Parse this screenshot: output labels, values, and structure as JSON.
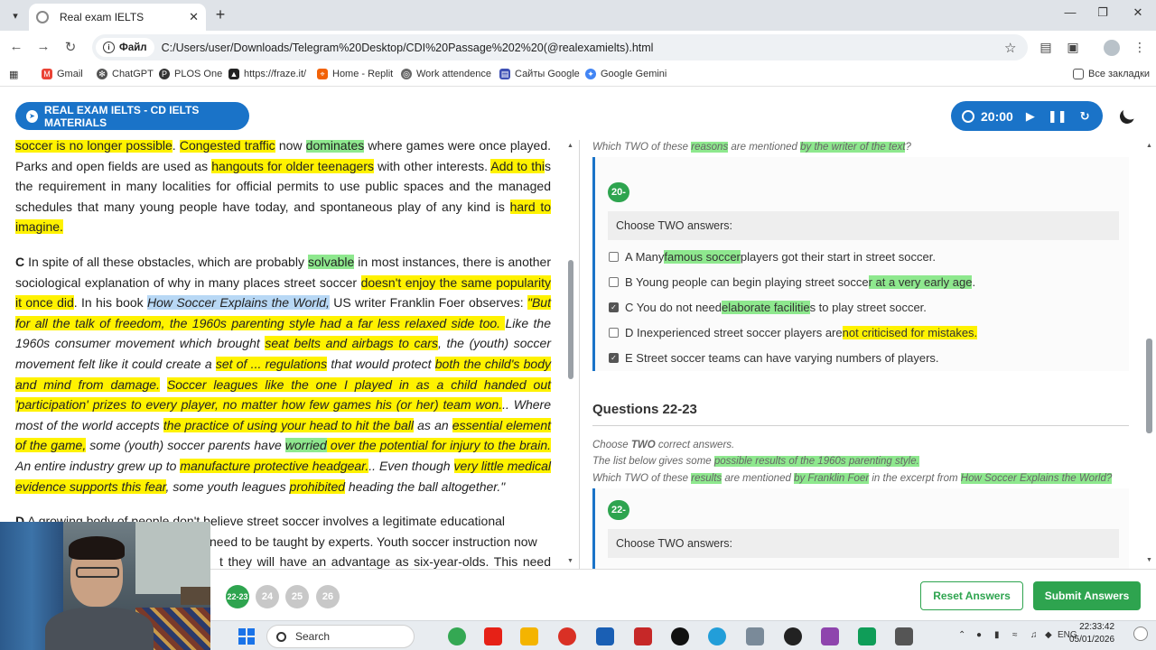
{
  "browser": {
    "tab_title": "Real exam IELTS",
    "file_chip": "Файл",
    "url": "C:/Users/user/Downloads/Telegram%20Desktop/CDI%20Passage%202%20(@realexamielts).html",
    "bookmarks": [
      "Gmail",
      "ChatGPT",
      "PLOS One",
      "https://fraze.it/",
      "Home - Replit",
      "Work attendence",
      "Сайты Google",
      "Google Gemini"
    ],
    "all_bookmarks": "Все закладки"
  },
  "header": {
    "brand_label": "REAL EXAM IELTS - CD IELTS MATERIALS",
    "timer": "20:00"
  },
  "passage": {
    "p1": {
      "s1": "soccer is no longer possible",
      "s2": ". ",
      "s3": "Congested traffic",
      "s4": " now ",
      "s5": "dominates",
      "s6": " where games were once played. Parks and open fields are used as ",
      "s7": "hangouts for older teenagers",
      "s8": " with other interests. ",
      "s9": "Add to thi",
      "s10": "s the requirement in many localities for official permits to use public spaces and the managed schedules that many young people have today, and spontaneous play of any kind is ",
      "s11": "hard to imagine."
    },
    "p2": {
      "letter": "C",
      "s1": " In spite of all these obstacles, which are probably ",
      "s2": "solvable",
      "s3": " in most instances, there is another sociological explanation of why in many places street soccer ",
      "s4": "doesn't enjoy the same popularity it once did",
      "s5": ". In his book ",
      "s6": "How Soccer Explains the World,",
      "s7": " US writer Franklin Foer observes: ",
      "s8": "\"But for all the talk of freedom, the 1960s parenting style had a far less relaxed side too. ",
      "s9": "Like the 1960s consumer movement which brought ",
      "s10": "seat belts and airbags to cars",
      "s11": ", the (youth) soccer movement felt like it could create a ",
      "s12": "set of ... regulations",
      "s13": " that would protect ",
      "s14": "both the child's body and mind from damage.",
      "s15": " ",
      "s16": "Soccer leagues like the one I played in as a child handed out 'participation' prizes to every player, no matter how few games his (or her) team won.",
      "s17": ".. Where most of the world accepts ",
      "s18": "the practice of using your head to hit the ball",
      "s19": " as an ",
      "s20": "essential element of the game,",
      "s21": " some (youth) soccer parents have ",
      "s22": "worried",
      "s23": " over the potential for injury to the brain.",
      "s24": " An entire industry grew up to ",
      "s25": "manufacture protective headgear.",
      "s26": ".. Even though ",
      "s27": "very little medical evidence supports this fear",
      "s28": ", some youth leagues ",
      "s29": "prohibited",
      "s30": " heading the ball altogether.\""
    },
    "p3": {
      "letter": "D",
      "s1": " A growing body of people don't believe street soccer involves a legitimate educational",
      "s2": "need to be taught by experts. Youth soccer instruction now",
      "s3": "t they will have an advantage as six-year-olds. This need to"
    }
  },
  "q20": {
    "instr": {
      "a": "Which TWO of these ",
      "b": "reasons",
      "c": " are mentioned ",
      "d": "by the writer of the text",
      "e": "?"
    },
    "number": "20-",
    "choose": "Choose TWO answers:",
    "options": [
      {
        "a": "A Many ",
        "b": "famous soccer",
        "c": " players got their start in street soccer.",
        "d": ""
      },
      {
        "a": "B Young people can begin playing street socce",
        "b": "r at a very early age",
        "c": ".",
        "d": ""
      },
      {
        "a": "C You do not need ",
        "b": "elaborate facilitie",
        "c": "s to play street soccer.",
        "d": ""
      },
      {
        "a": "D Inexperienced street soccer players are ",
        "b": "not criticised for mistakes.",
        "c": "",
        "d": ""
      },
      {
        "a": "E Street soccer teams can have varying numbers of players.",
        "b": "",
        "c": "",
        "d": ""
      }
    ],
    "checked": [
      false,
      false,
      true,
      false,
      true
    ]
  },
  "q22": {
    "heading": "Questions 22-23",
    "instr1_a": "Choose ",
    "instr1_b": "TWO",
    "instr1_c": " correct answers.",
    "instr2_a": "The list below gives some ",
    "instr2_b": "possible results of the 1960s parenting style.",
    "instr3_a": "Which TWO of these ",
    "instr3_b": "results",
    "instr3_c": " are mentioned ",
    "instr3_d": "by Franklin Foer",
    "instr3_e": " in the excerpt from ",
    "instr3_f": "How Soccer Explains the World?",
    "number": "22-",
    "choose": "Choose TWO answers:"
  },
  "nav": {
    "active": "22-23",
    "dots": [
      "24",
      "25",
      "26"
    ],
    "reset": "Reset Answers",
    "submit": "Submit Answers"
  },
  "taskbar": {
    "search": "Search",
    "lang": "ENG",
    "time": "22:33:42",
    "date": "05/01/2026"
  },
  "colors": {
    "accent_blue": "#1a73c8",
    "green": "#2ea44f",
    "highlight_yellow": "#fff200",
    "highlight_green": "#8ee88e"
  }
}
